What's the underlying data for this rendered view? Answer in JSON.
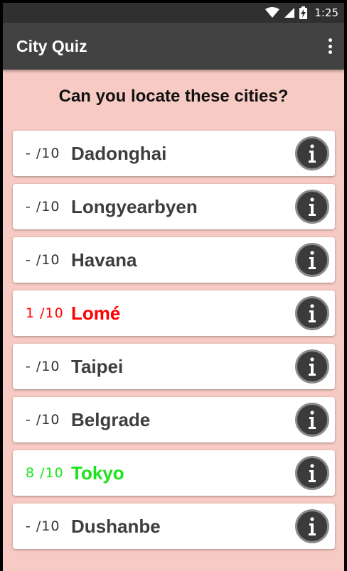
{
  "status_bar": {
    "time": "1:25"
  },
  "app_bar": {
    "title": "City Quiz",
    "menu_icon": "more-vert-icon"
  },
  "heading": "Can you locate these cities?",
  "colors": {
    "wrong": "#ff0000",
    "right": "#19e419",
    "default": "#3e3e3e",
    "background": "#f7cbc3"
  },
  "cities": [
    {
      "score": "- /10",
      "name": "Dadonghai",
      "status": "default"
    },
    {
      "score": "- /10",
      "name": "Longyearbyen",
      "status": "default"
    },
    {
      "score": "- /10",
      "name": "Havana",
      "status": "default"
    },
    {
      "score": "1 /10",
      "name": "Lomé",
      "status": "wrong"
    },
    {
      "score": "- /10",
      "name": "Taipei",
      "status": "default"
    },
    {
      "score": "- /10",
      "name": "Belgrade",
      "status": "default"
    },
    {
      "score": "8 /10",
      "name": "Tokyo",
      "status": "right"
    },
    {
      "score": "- /10",
      "name": "Dushanbe",
      "status": "default"
    }
  ]
}
